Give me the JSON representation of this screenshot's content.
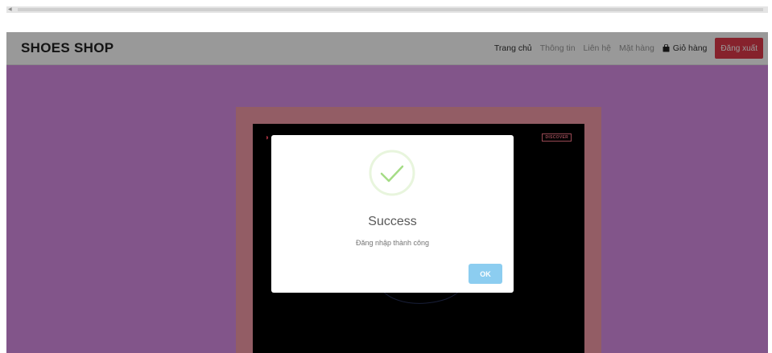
{
  "navbar": {
    "brand": "SHOES SHOP",
    "links": [
      "Trang chủ",
      "Thông tin",
      "Liên hệ",
      "Mặt hàng"
    ],
    "active_link": "Trang chủ",
    "cart_label": "Giỏ hàng",
    "logout_label": "Đăng xuất"
  },
  "hero": {
    "badge": "DISCOVER"
  },
  "modal": {
    "title": "Success",
    "message": "Đăng nhập thành công",
    "ok_label": "OK"
  },
  "colors": {
    "page_background": "#d98ee6",
    "navbar_background": "#ffffff",
    "hero_frame": "#f69ba8",
    "logout_button": "#e03a4a",
    "success_green": "#a5dc86",
    "ok_button": "#8ccdf0",
    "overlay": "rgba(0,0,0,0.4)"
  },
  "icons": [
    "cart-icon",
    "success-check-icon",
    "brand-logo-icon",
    "scroll-left-arrow-icon"
  ]
}
